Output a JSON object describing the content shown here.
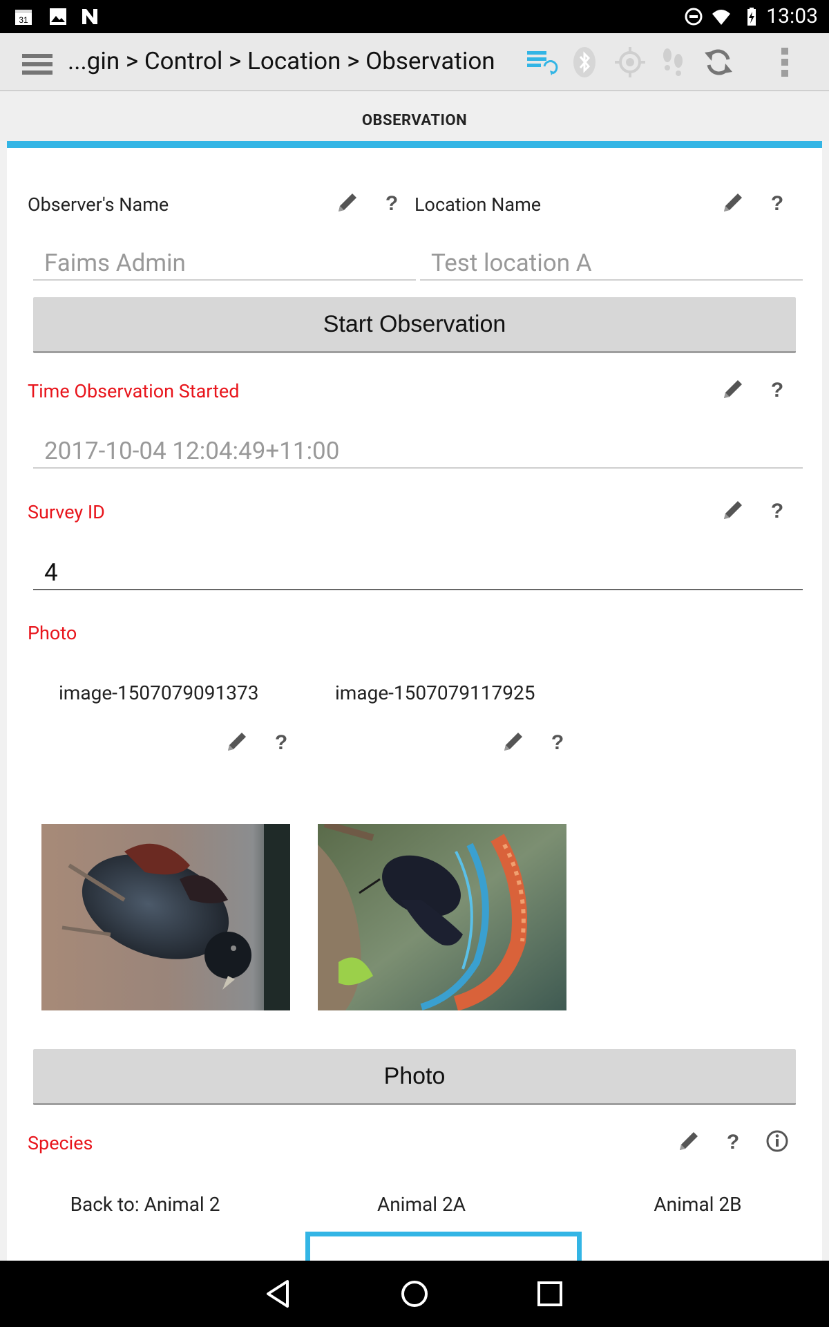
{
  "status_bar": {
    "time": "13:03",
    "left_icons": [
      "calendar-icon",
      "image-icon",
      "n-icon"
    ],
    "right_icons": [
      "do-not-disturb-icon",
      "wifi-icon",
      "battery-icon"
    ]
  },
  "action_bar": {
    "breadcrumb": "...gin > Control > Location > Observation",
    "icons": [
      "menu-icon",
      "sync-status-icon",
      "bluetooth-icon",
      "gps-icon",
      "tracking-icon",
      "refresh-icon",
      "overflow-menu-icon"
    ]
  },
  "tab": {
    "title": "OBSERVATION",
    "accent": "#33b5e5"
  },
  "form": {
    "observer_name": {
      "label": "Observer's Name",
      "placeholder": "Faims Admin"
    },
    "location_name": {
      "label": "Location Name",
      "placeholder": "Test location A"
    },
    "start_button": "Start Observation",
    "time_started": {
      "label": "Time Observation Started",
      "placeholder": "2017-10-04 12:04:49+11:00"
    },
    "survey_id": {
      "label": "Survey ID",
      "value": "4"
    },
    "photo": {
      "label": "Photo",
      "images": [
        {
          "name": "image-1507079091373"
        },
        {
          "name": "image-1507079117925"
        }
      ],
      "button": "Photo"
    },
    "species": {
      "label": "Species"
    },
    "required_color": "#e8141b"
  },
  "bottom_tabs": [
    "Back to: Animal 2",
    "Animal 2A",
    "Animal 2B"
  ]
}
